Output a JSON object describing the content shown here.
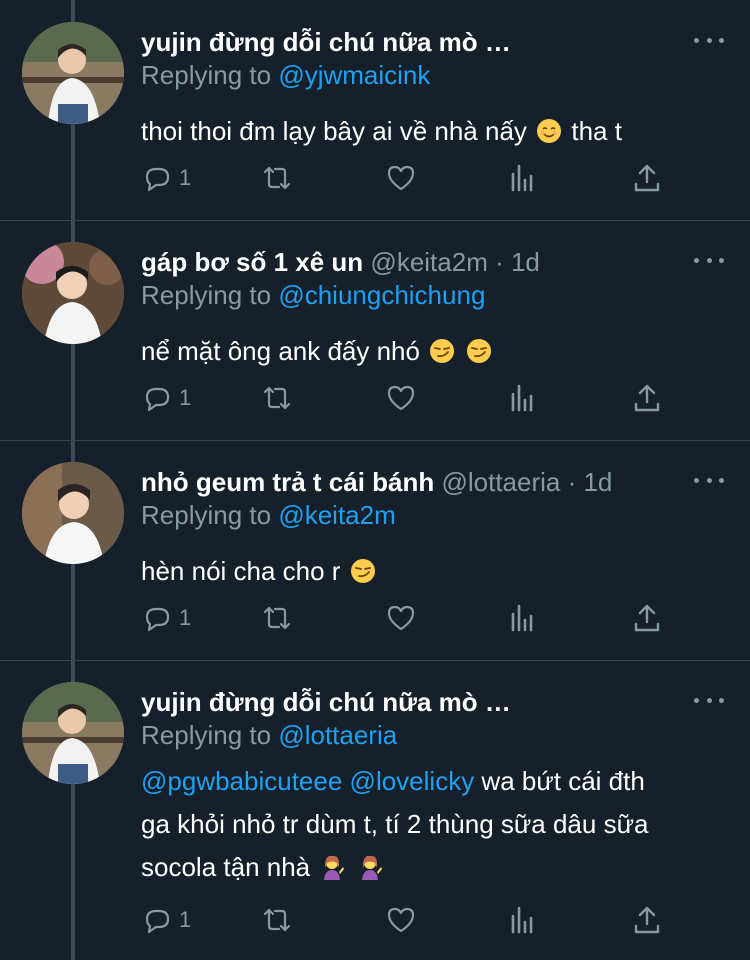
{
  "tweets": [
    {
      "name": "yujin đừng dỗi chú nữa mò …",
      "handle": "",
      "replying_prefix": "Replying to ",
      "replying_to": "@yjwmaicink",
      "body_text": "thoi thoi đm lạy bây ai về nhà nấy",
      "body_tail": " tha t",
      "emoji": [
        "relieved-smile"
      ],
      "reply_count": "1"
    },
    {
      "name": "gáp bơ số 1 xê un",
      "handle": " @keita2m · 1d",
      "replying_prefix": "Replying to ",
      "replying_to": "@chiungchichung",
      "body_text": "nể mặt ông ank đấy nhó",
      "emoji": [
        "smirk",
        "smirk"
      ],
      "reply_count": "1"
    },
    {
      "name": "nhỏ geum trả t cái bánh",
      "handle": " @lottaeria · 1d",
      "replying_prefix": "Replying to ",
      "replying_to": "@keita2m",
      "body_text": "hèn nói cha cho r",
      "emoji": [
        "smirk"
      ],
      "reply_count": "1"
    },
    {
      "name": "yujin đừng dỗi chú nữa mò …",
      "handle": "",
      "replying_prefix": "Replying to ",
      "replying_to": "@lottaeria",
      "body_mention_1": "@pgwbabicuteee",
      "body_mention_2": "@lovelicky",
      "body_line_1_rest": " wa bứt cái đth",
      "body_line_2": "ga khỏi nhỏ tr dùm t, tí 2 thùng sữa dâu sữa",
      "body_line_3": "socola tận nhà",
      "emoji": [
        "woman-tipping-hand",
        "woman-tipping-hand"
      ],
      "reply_count": "1"
    }
  ],
  "icons": {
    "reply": "reply-icon",
    "retweet": "retweet-icon",
    "like": "heart-icon",
    "analytics": "analytics-icon",
    "share": "share-icon",
    "more": "more-icon"
  },
  "colors": {
    "background": "#15202b",
    "secondary_text": "#8899a6",
    "mention": "#1da1f2",
    "divider": "#38444d"
  }
}
